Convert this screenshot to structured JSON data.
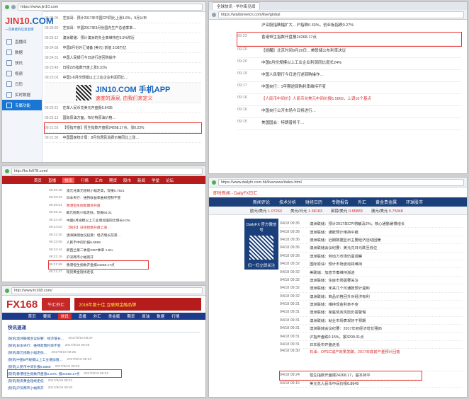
{
  "jin10": {
    "url": "https://www.jin10.com",
    "tab": "金十数据",
    "logo_main": "JIN10",
    "logo_tld": ".COM",
    "slogan": "一交易者的信息宝库",
    "menu": [
      "直播间",
      "数据",
      "快讯",
      "视频",
      "日历",
      "实时数据",
      "专属功能"
    ],
    "banner_brand": "JIN10.COM 手机APP",
    "banner_tagline": "速度的源泉, 由我们来定义",
    "feed": [
      {
        "time": "09:26:06",
        "text": "芝加哥：预计2017年中国CPI同比上涨1.6%，9月公布"
      },
      {
        "time": "09:25:50",
        "text": "芝加哥：中国2017年9月份国内生产总值季率…"
      },
      {
        "time": "09:25:12",
        "text": "澳洲联储：预计澳洲的失业率维持在5.5%附近"
      },
      {
        "time": "09:24:58",
        "text": "中国8月份外汇储备 (美元) 前值 3.08万亿"
      },
      {
        "time": "09:24:31",
        "text": "中国人民银行今日进行逆回购操作"
      },
      {
        "time": "09:23:40",
        "text": "日经225指数开盘上涨0.31%"
      },
      {
        "time": "09:23:02",
        "text": "中国1-8月份规模以上工业企业利润同比…"
      },
      {
        "time": "09:22:21",
        "text": "在岸人民币兑美元开盘报6.6435"
      },
      {
        "time": "09:22:13",
        "text": "国际原油方面，布伦特原油价格…"
      },
      {
        "time": "09:21:55",
        "text": "【恒指开盘】恒生指数开盘报24268.17点，涨0.23%"
      },
      {
        "time": "09:21:30",
        "text": "中国国家统计局：8月份居民消费价格同比上涨…"
      }
    ],
    "highlight_row": "【恒指开盘】恒生指数开盘报24268.17点，涨0.23%"
  },
  "fx678": {
    "url": "http://kx.fx678.com/",
    "nav": [
      "首页",
      "直播",
      "快讯",
      "行情",
      "汇市",
      "期货",
      "股市",
      "新闻",
      "学堂",
      "论坛"
    ],
    "feed": [
      {
        "time": "09:26:48",
        "text": "澳元兑美元短线小幅走高，现报0.7921"
      },
      {
        "time": "09:26:23",
        "text": "日本央行：维持收益率曲线控制不变"
      },
      {
        "time": "09:25:51",
        "text": "香港恒生指数期货开盘"
      },
      {
        "time": "09:25:11",
        "text": "美元指数小幅走低，现报93.21"
      },
      {
        "time": "09:24:40",
        "text": "中国8月规模以上工业增加值同比增长6.0%"
      },
      {
        "time": "09:24:02",
        "text": "【快讯】日经指数开盘上涨"
      },
      {
        "time": "09:23:30",
        "text": "澳洲联储会议纪要：经济增长前景…"
      },
      {
        "time": "09:23:05",
        "text": "人民币中间价报6.5869"
      },
      {
        "time": "09:22:44",
        "text": "新西兰第二季度GDP季率 1.5%"
      },
      {
        "time": "09:22:15",
        "text": "沪深两市小幅高开"
      },
      {
        "time": "09:21:58",
        "text": "香港恒生指数开盘报24268.17点"
      },
      {
        "time": "09:21:37",
        "text": "现货黄金短线走低"
      }
    ],
    "highlight_row": "香港恒生指数开盘报24268.17点"
  },
  "fx168": {
    "url": "http://www.fx168.com/",
    "logo": "FX168",
    "ad1": "牛汇外汇",
    "ad2": "2016年度十佳 互联网金融品牌",
    "nav": [
      "首页",
      "要闻",
      "快讯",
      "直播",
      "外汇",
      "贵金属",
      "期货",
      "原油",
      "数据",
      "行情"
    ],
    "section_title": "快讯速递",
    "feed": [
      {
        "time": "2017/9/19 09:27",
        "text": "[快讯]澳洲联储会议纪要：经济增长…"
      },
      {
        "time": "2017/9/19 09:26",
        "text": "[快讯]日本央行：维持政策利率不变"
      },
      {
        "time": "2017/9/19 09:25",
        "text": "[快讯]美元指数小幅走低…"
      },
      {
        "time": "2017/9/19 09:24",
        "text": "[快讯]中国8月规模以上工业增加值…"
      },
      {
        "time": "2017/9/19 09:23",
        "text": "[快讯]人民币中间价报6.5869"
      },
      {
        "time": "2017/9/19 09:22",
        "text": "[快讯]香港恒生指数开盘涨0.23%, 报24268.17点"
      },
      {
        "time": "2017/9/19 09:21",
        "text": "[快讯]现货黄金短线走低"
      },
      {
        "time": "2017/9/19 09:20",
        "text": "[快讯]沪深两市小幅高开"
      }
    ],
    "highlight_row": "[快讯]香港恒生指数开盘涨0.23%, 报24268.17点"
  },
  "wallstreetcn": {
    "url": "https://wallstreetcn.com/live/global",
    "tab": "全球快讯 - 华尔街见闻",
    "feed": [
      {
        "time": "",
        "text": "沪深股指跌幅扩大…沪指跌0.33%，创业板指跌0.27%"
      },
      {
        "time": "09:22",
        "text": "香港恒生指数开盘报24268.17点"
      },
      {
        "time": "09:20",
        "text": "【提醒】北京时间9月20日…美联储公布利率决议"
      },
      {
        "time": "09:20",
        "text": "中国8月份规模以上工业企业利润同比增长24%"
      },
      {
        "time": "09:19",
        "text": "中国人民银行今日进行逆回购操作…"
      },
      {
        "time": "09:17",
        "text": "中国央行：1年期逆回购利率维持不变"
      },
      {
        "time": "09:16",
        "text": "【人民币中间价】人民币兑美元中间价报6.5869，上调16个基点"
      },
      {
        "time": "09:16",
        "text": "中国央行公开市场今日将进行…"
      },
      {
        "time": "09:15",
        "text": "美国国会：特朗普将于…"
      }
    ],
    "highlight_row": "香港恒生指数开盘报24268.17点"
  },
  "dailyfx": {
    "url": "https://www.dailyfx.com.hk/livenews/index.html",
    "tab": "即时新闻 - DailyFX日汇",
    "nav": [
      "新闻评论",
      "技术分析",
      "财经日历",
      "专题报告",
      "外汇",
      "黄金贵金属",
      "环球股市"
    ],
    "ticker": [
      {
        "label": "欧元/美元",
        "value": "1.07263"
      },
      {
        "label": "美元/日元",
        "value": "1.38183"
      },
      {
        "label": "英镑/美元",
        "value": "0.85883"
      },
      {
        "label": "澳元/美元",
        "value": "0.75048"
      }
    ],
    "promo_title": "DailyFX 官方微信号",
    "promo_footer": "扫一扫立即关注",
    "feed": [
      {
        "time": "04/18 09:36",
        "text": "澳洲联储：预计2017年CPI将触及2%；核心通胀缓慢增长",
        "red": false
      },
      {
        "time": "04/18 09:36",
        "text": "澳洲联储：通胀预计维持平稳",
        "red": false
      },
      {
        "time": "04/18 09:36",
        "text": "澳洲联储：近期数据显示主要经济活动回暖",
        "red": false
      },
      {
        "time": "04/18 09:36",
        "text": "澳洲联储会议纪要：美元兑日元跌至低位",
        "red": false
      },
      {
        "time": "04/18 09:36",
        "text": "澳洲联储：劳动力市场仍需观察",
        "red": false
      },
      {
        "time": "04/18 09:32",
        "text": "国际原油：预计市场波动将维持",
        "red": false
      },
      {
        "time": "04/18 09:32",
        "text": "美联储：加息节奏维持渐进",
        "red": false
      },
      {
        "time": "04/18 09:32",
        "text": "澳洲联储：住房市场需要关注",
        "red": false
      },
      {
        "time": "04/18 09:32",
        "text": "澳洲联储：未来几个月通胀预计温和",
        "red": false
      },
      {
        "time": "04/18 09:32",
        "text": "澳洲联储：商品价格回升对经济有利",
        "red": false
      },
      {
        "time": "04/18 09:31",
        "text": "澳洲联储：维持现金利率不变",
        "red": false
      },
      {
        "time": "04/18 09:31",
        "text": "澳洲联储：家庭债务风险仍需警惕",
        "red": false
      },
      {
        "time": "04/18 09:31",
        "text": "澳洲联储：就业市场表现好于预期",
        "red": false
      },
      {
        "time": "04/18 09:31",
        "text": "澳洲联储会议纪要：2017年初经济增长强劲",
        "red": false
      },
      {
        "time": "04/18 09:31",
        "text": "沪指开盘跌0.15%，报3209.01点",
        "red": false
      },
      {
        "time": "04/18 09:31",
        "text": "日本股市开盘走低",
        "red": false
      },
      {
        "time": "04/18 09:30",
        "text": "石油：OPEC减产效果发酵，2017年底前产量预计回落",
        "red": true
      },
      {
        "time": "04/18 09:24",
        "text": "恒生指数开盘报24268.17，基本持平",
        "red": false
      },
      {
        "time": "04/18 09:15",
        "text": "美元兑人民币中间价报6.8649",
        "red": false
      }
    ],
    "highlight_row": "恒生指数开盘报24268.17，基本持平"
  }
}
